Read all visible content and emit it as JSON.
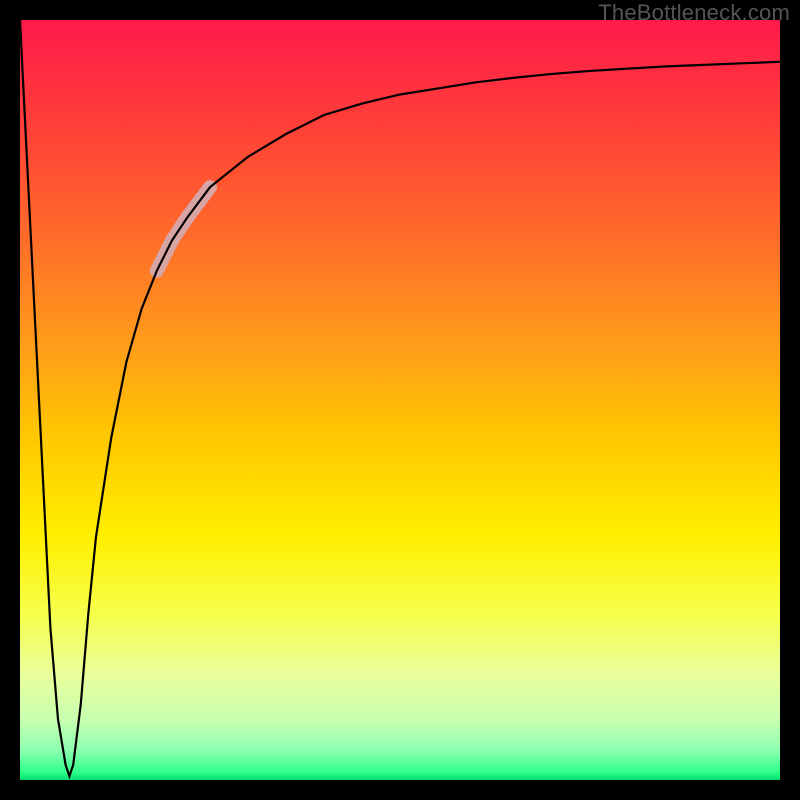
{
  "watermark": "TheBottleneck.com",
  "colors": {
    "background": "#000000",
    "curve": "#000000",
    "highlight": "#d8a4a4",
    "gradient_start": "#ff1a4b",
    "gradient_end": "#00e070"
  },
  "chart_data": {
    "type": "line",
    "title": "",
    "xlabel": "",
    "ylabel": "",
    "xlim": [
      0,
      100
    ],
    "ylim": [
      0,
      100
    ],
    "grid": false,
    "legend": false,
    "note": "y values are estimated from pixel positions; axes have no printed tick labels",
    "series": [
      {
        "name": "curve",
        "x": [
          0,
          1,
          2,
          3,
          4,
          5,
          6,
          6.5,
          7,
          8,
          9,
          10,
          12,
          14,
          16,
          18,
          20,
          22,
          25,
          30,
          35,
          40,
          45,
          50,
          55,
          60,
          65,
          70,
          75,
          80,
          85,
          90,
          95,
          100
        ],
        "y": [
          100,
          80,
          60,
          40,
          20,
          8,
          2,
          0.5,
          2,
          10,
          22,
          32,
          45,
          55,
          62,
          67,
          71,
          74,
          78,
          82,
          85,
          87.5,
          89,
          90.2,
          91,
          91.8,
          92.4,
          92.9,
          93.3,
          93.6,
          93.9,
          94.1,
          94.3,
          94.5
        ]
      }
    ],
    "highlight_segment": {
      "x_start": 18,
      "x_end": 26,
      "description": "thicker pale-pink band overlaid on the curve"
    }
  }
}
